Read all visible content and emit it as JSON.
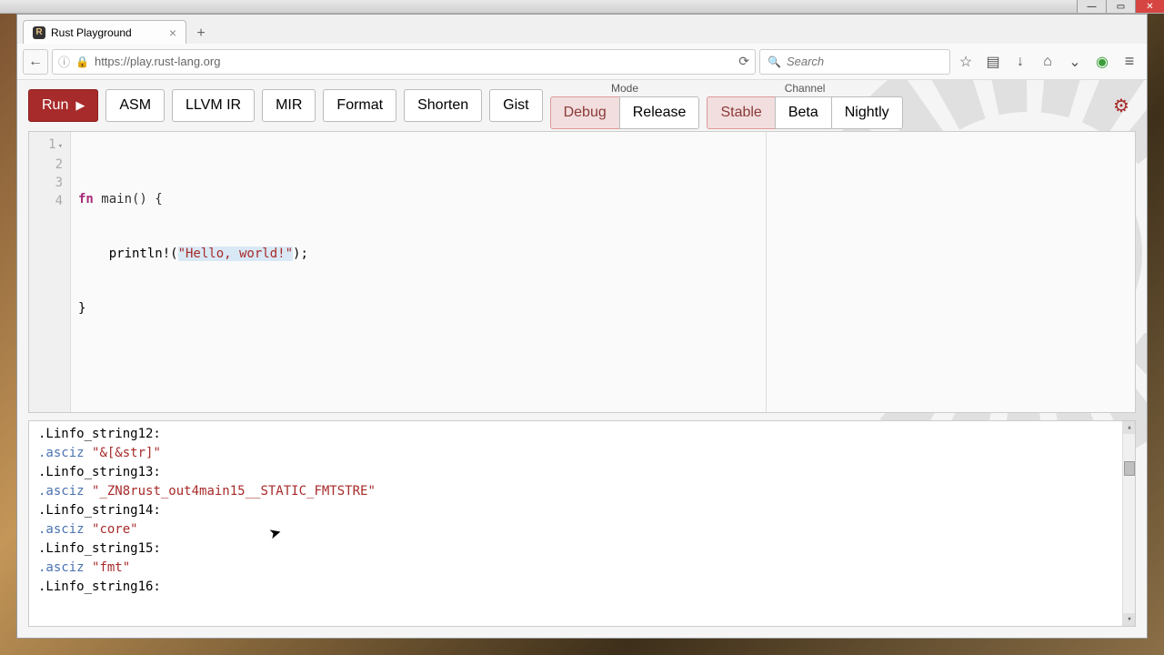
{
  "window": {
    "tab_title": "Rust Playground",
    "url": "https://play.rust-lang.org",
    "search_placeholder": "Search"
  },
  "toolbar": {
    "run": "Run",
    "asm": "ASM",
    "llvm": "LLVM IR",
    "mir": "MIR",
    "format": "Format",
    "shorten": "Shorten",
    "gist": "Gist",
    "mode_label": "Mode",
    "channel_label": "Channel",
    "mode": {
      "debug": "Debug",
      "release": "Release",
      "active": "debug"
    },
    "channel": {
      "stable": "Stable",
      "beta": "Beta",
      "nightly": "Nightly",
      "active": "stable"
    }
  },
  "editor": {
    "lines": [
      {
        "n": 1,
        "foldable": true
      },
      {
        "n": 2,
        "foldable": false
      },
      {
        "n": 3,
        "foldable": false
      },
      {
        "n": 4,
        "foldable": false
      }
    ],
    "code": {
      "l1_kw": "fn",
      "l1_rest": " main() {",
      "l2_pre": "    println!(",
      "l2_str": "\"Hello, world!\"",
      "l2_post": ");",
      "l3": "}",
      "l4": ""
    }
  },
  "output": {
    "items": [
      {
        "label": ".Linfo_string12:",
        "asciz": ".asciz",
        "val": "\"&[&str]\""
      },
      {
        "label": ".Linfo_string13:",
        "asciz": ".asciz",
        "val": "\"_ZN8rust_out4main15__STATIC_FMTSTRE\""
      },
      {
        "label": ".Linfo_string14:",
        "asciz": ".asciz",
        "val": "\"core\""
      },
      {
        "label": ".Linfo_string15:",
        "asciz": ".asciz",
        "val": "\"fmt\""
      },
      {
        "label": ".Linfo_string16:",
        "asciz": "",
        "val": ""
      }
    ]
  },
  "colors": {
    "accent": "#a72b2a",
    "active_bg": "#f2dede"
  }
}
